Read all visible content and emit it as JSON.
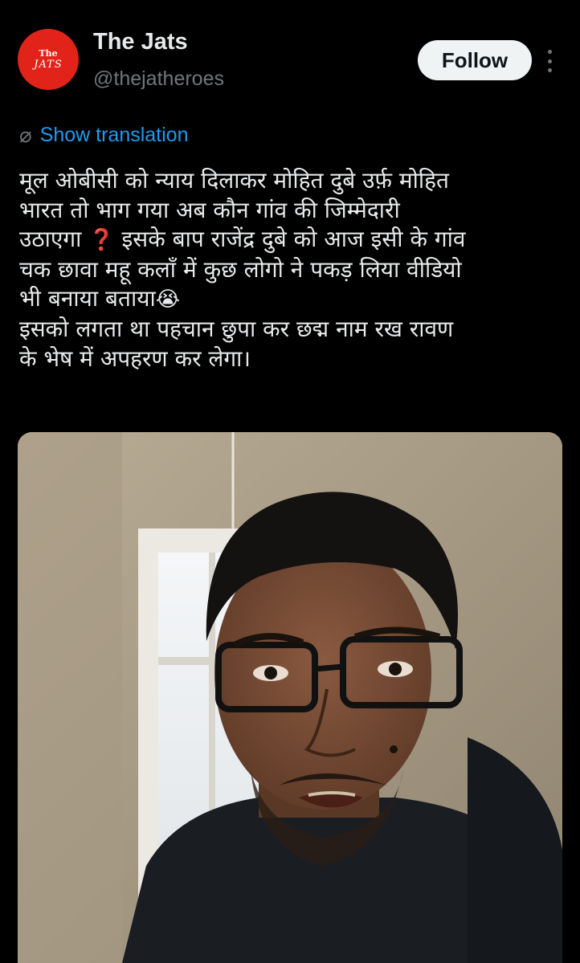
{
  "account": {
    "avatar_line1": "The",
    "avatar_line2": "JATS",
    "name": "The Jats",
    "handle": "@thejatheroes"
  },
  "actions": {
    "follow_label": "Follow",
    "more_icon": "more-vertical-icon"
  },
  "translation": {
    "label": "Show translation",
    "icon": "globe-icon"
  },
  "post": {
    "line1": "मूल ओबीसी को न्याय दिलाकर मोहित दुबे उर्फ़ मोहित",
    "line2": "भारत तो भाग गया अब कौन गांव की जिम्मेदारी",
    "line3a": "उठाएगा ",
    "line3_emoji": "❓",
    "line3b": " इसके बाप राजेंद्र दुबे को आज इसी के गांव",
    "line4": "चक छावा महू कलाँ में कुछ लोगो ने पकड़ लिया वीडियो",
    "line5": "भी बनाया बताया",
    "line5_emoji": "😭",
    "line6": "इसको लगता था पहचान छुपा कर छद्म नाम रख रावण",
    "line7": "के भेष में अपहरण कर लेगा।"
  },
  "media": {
    "type": "video-thumbnail"
  },
  "colors": {
    "background": "#000000",
    "text": "#e7e9ea",
    "secondary": "#71767b",
    "link": "#1d9bf0",
    "avatar_bg": "#e2231a"
  }
}
